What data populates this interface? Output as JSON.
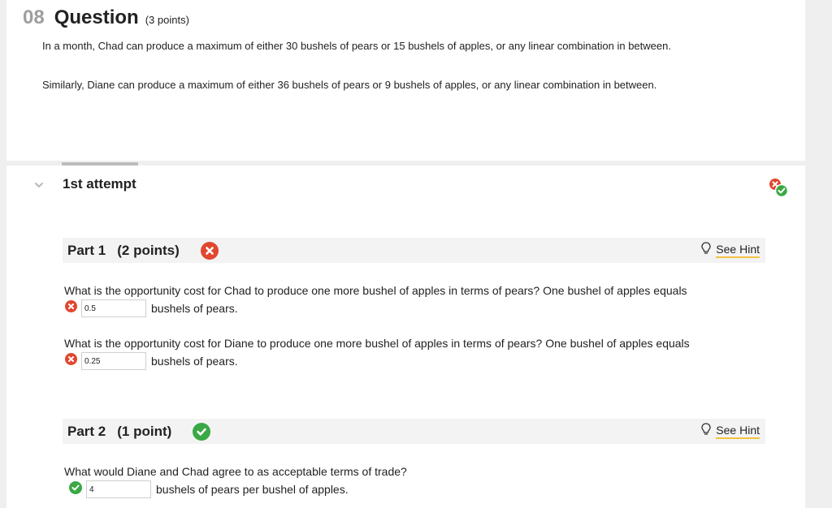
{
  "question": {
    "number": "08",
    "title": "Question",
    "points": "(3 points)",
    "prompt_1": "In a month, Chad can produce a maximum of either 30 bushels of pears or 15 bushels of apples, or any linear combination in between.",
    "prompt_2": "Similarly, Diane can produce a maximum of either 36 bushels of pears or 9 bushels of apples, or any linear combination in between."
  },
  "attempt": {
    "title": "1st attempt",
    "status_icon": "incorrect-correct-combo-icon"
  },
  "part1": {
    "label": "Part 1",
    "points": "(2 points)",
    "status": "incorrect",
    "hint_label": "See Hint",
    "q1_text": "What is the opportunity cost for Chad to produce one more bushel of apples in terms of pears? One bushel of apples equals",
    "q1_value": "0.5",
    "q1_suffix": "bushels of pears.",
    "q2_text": "What is the opportunity cost for Diane to produce one more bushel of apples in terms of pears? One bushel of apples equals",
    "q2_value": "0.25",
    "q2_suffix": "bushels of pears."
  },
  "part2": {
    "label": "Part 2",
    "points": "(1 point)",
    "status": "correct",
    "hint_label": "See Hint",
    "q1_text": "What would Diane and Chad agree to as acceptable terms of trade?",
    "q1_value": "4",
    "q1_suffix": "bushels of pears per bushel of apples."
  },
  "colors": {
    "incorrect": "#e0472f",
    "correct": "#3aa845",
    "hint_underline": "#f4c342"
  }
}
